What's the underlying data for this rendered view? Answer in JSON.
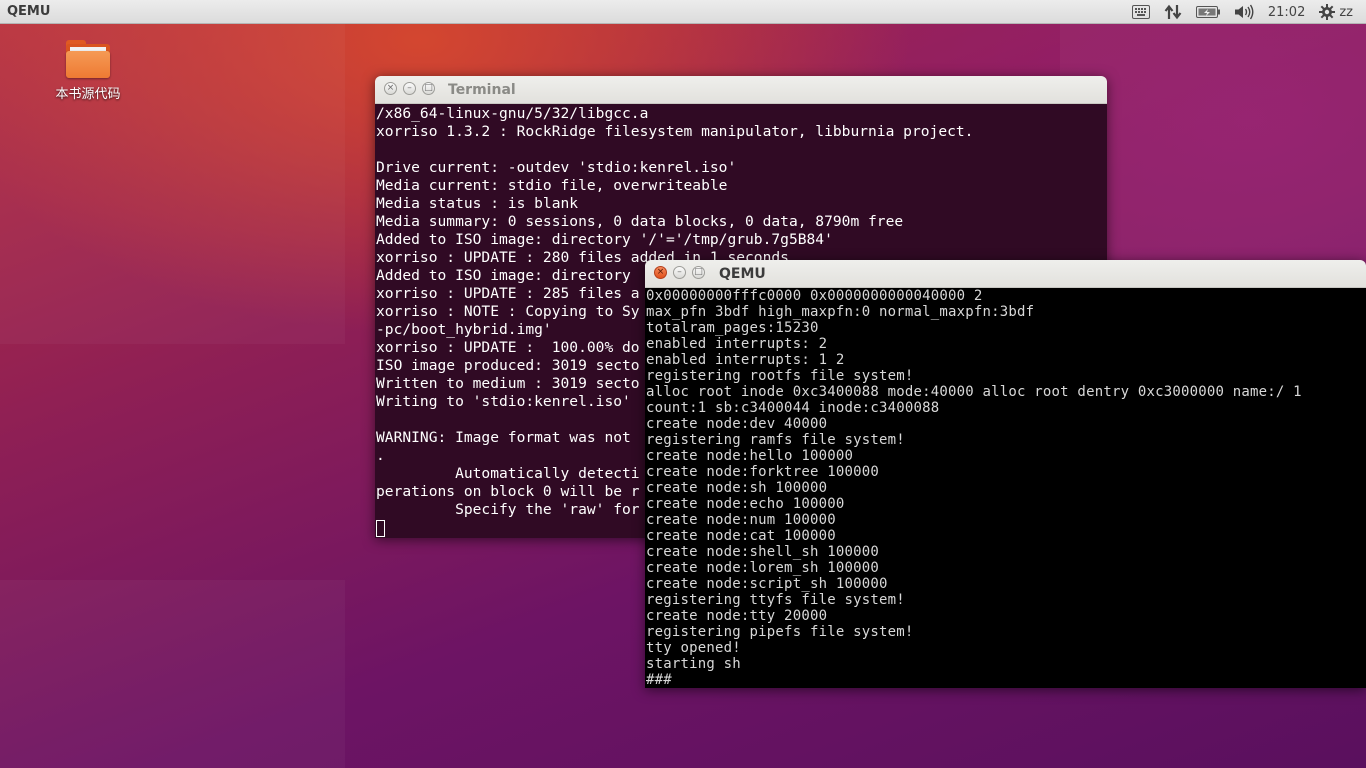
{
  "top_panel": {
    "app_title": "QEMU",
    "indicators": {
      "keyboard_icon": "keyboard-icon",
      "network_icon": "network-updown-icon",
      "battery_icon": "battery-icon",
      "volume_icon": "volume-icon",
      "clock": "21:02",
      "settings_icon": "gear-icon",
      "user": "zz"
    }
  },
  "desktop": {
    "icons": [
      {
        "label": "本书源代码",
        "icon": "folder-icon"
      }
    ]
  },
  "terminal_window": {
    "title": "Terminal",
    "buttons": {
      "close": "×",
      "minimize": "–",
      "maximize": "□"
    },
    "lines": [
      "/x86_64-linux-gnu/5/32/libgcc.a",
      "xorriso 1.3.2 : RockRidge filesystem manipulator, libburnia project.",
      "",
      "Drive current: -outdev 'stdio:kenrel.iso'",
      "Media current: stdio file, overwriteable",
      "Media status : is blank",
      "Media summary: 0 sessions, 0 data blocks, 0 data, 8790m free",
      "Added to ISO image: directory '/'='/tmp/grub.7g5B84'",
      "xorriso : UPDATE : 280 files added in 1 seconds",
      "Added to ISO image: directory",
      "xorriso : UPDATE : 285 files a",
      "xorriso : NOTE : Copying to Sy",
      "-pc/boot_hybrid.img'",
      "xorriso : UPDATE :  100.00% do",
      "ISO image produced: 3019 secto",
      "Written to medium : 3019 secto",
      "Writing to 'stdio:kenrel.iso'",
      "",
      "WARNING: Image format was not",
      ".",
      "         Automatically detecti",
      "perations on block 0 will be r",
      "         Specify the 'raw' for"
    ]
  },
  "qemu_window": {
    "title": "QEMU",
    "buttons": {
      "close": "×",
      "minimize": "–",
      "maximize": "□"
    },
    "lines": [
      "0x00000000fffc0000 0x0000000000040000 2",
      "max_pfn 3bdf high_maxpfn:0 normal_maxpfn:3bdf",
      "totalram_pages:15230",
      "enabled interrupts: 2",
      "enabled interrupts: 1 2",
      "registering rootfs file system!",
      "alloc root inode 0xc3400088 mode:40000 alloc root dentry 0xc3000000 name:/ 1",
      "count:1 sb:c3400044 inode:c3400088",
      "create node:dev 40000",
      "registering ramfs file system!",
      "create node:hello 100000",
      "create node:forktree 100000",
      "create node:sh 100000",
      "create node:echo 100000",
      "create node:num 100000",
      "create node:cat 100000",
      "create node:shell_sh 100000",
      "create node:lorem_sh 100000",
      "create node:script_sh 100000",
      "registering ttyfs file system!",
      "create node:tty 20000",
      "registering pipefs file system!",
      "tty opened!",
      "starting sh",
      "###"
    ]
  },
  "colors": {
    "terminal_bg": "#300a24",
    "qemu_bg": "#000000",
    "close_button": "#e2511c",
    "folder": "#ee7a33"
  }
}
